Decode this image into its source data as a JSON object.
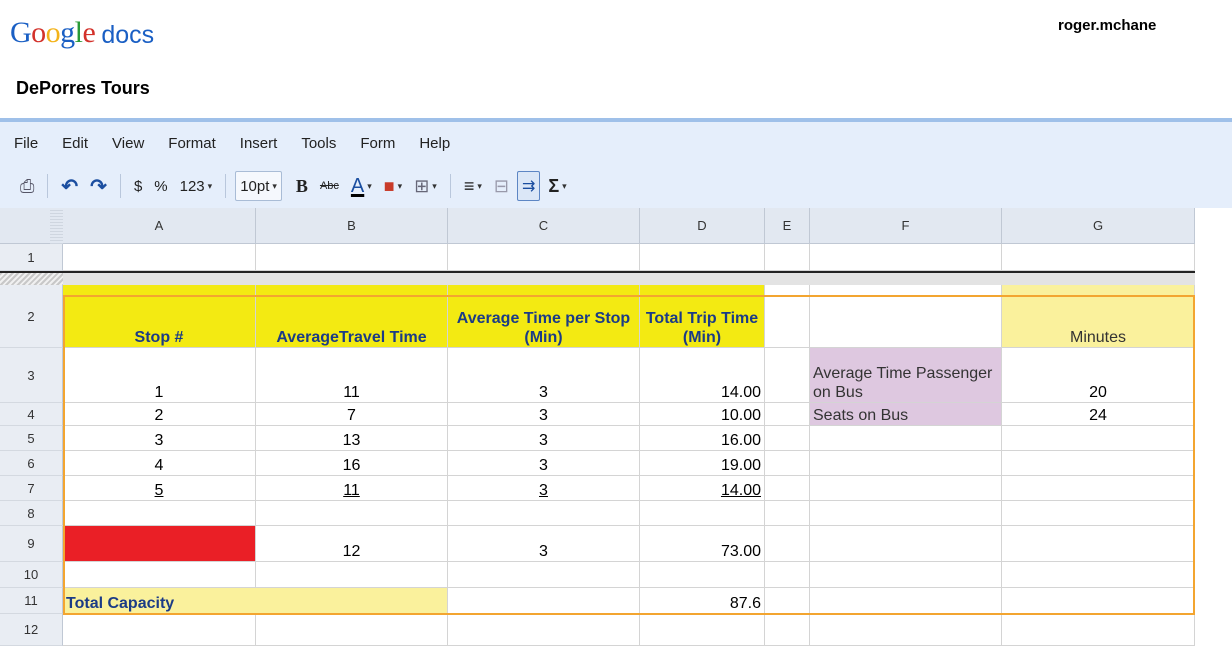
{
  "app": {
    "logo_google": [
      "G",
      "o",
      "o",
      "g",
      "l",
      "e"
    ],
    "logo_colors": [
      "#1a5fc4",
      "#d3312a",
      "#f3b31b",
      "#1a5fc4",
      "#2a9b38",
      "#d3312a"
    ],
    "logo_product": "docs",
    "user": "roger.mchane"
  },
  "document": {
    "title": "DePorres Tours"
  },
  "menu": [
    "File",
    "Edit",
    "View",
    "Format",
    "Insert",
    "Tools",
    "Form",
    "Help"
  ],
  "toolbar": {
    "print_icon": "⎙",
    "undo_icon": "↶",
    "redo_icon": "↷",
    "currency": "$",
    "percent": "%",
    "number_format": "123",
    "font_size": "10pt",
    "bold": "B",
    "strikethrough": "Abc",
    "text_color": "A",
    "fill_color": "■",
    "borders": "⊞",
    "align": "≡",
    "merge": "⊟",
    "wrap": "⇉",
    "functions": "Σ",
    "caret": "▾"
  },
  "columns": [
    "A",
    "B",
    "C",
    "D",
    "E",
    "F",
    "G"
  ],
  "rows": [
    "1",
    "2",
    "3",
    "4",
    "5",
    "6",
    "7",
    "8",
    "9",
    "10",
    "11",
    "12"
  ],
  "cells": {
    "a2": "Stop #",
    "b2": "AverageTravel Time",
    "c2": "Average Time per Stop (Min)",
    "d2": "Total Trip Time (Min)",
    "g2": "Minutes",
    "f3": "Average Time Passenger on Bus",
    "g3": "20",
    "f4": "Seats on Bus",
    "g4": "24",
    "table": [
      {
        "row": "3",
        "stop": "1",
        "travel": "11",
        "per_stop": "3",
        "total": "14.00"
      },
      {
        "row": "4",
        "stop": "2",
        "travel": "7",
        "per_stop": "3",
        "total": "10.00"
      },
      {
        "row": "5",
        "stop": "3",
        "travel": "13",
        "per_stop": "3",
        "total": "16.00"
      },
      {
        "row": "6",
        "stop": "4",
        "travel": "16",
        "per_stop": "3",
        "total": "19.00"
      },
      {
        "row": "7",
        "stop": "5",
        "travel": "11",
        "per_stop": "3",
        "total": "14.00"
      }
    ],
    "b9": "12",
    "c9": "3",
    "d9": "73.00",
    "a11": "Total Capacity",
    "d11": "87.6"
  },
  "colors": {
    "header_yellow": "#f3ea12",
    "light_yellow": "#faf19c",
    "purple": "#dec8e0",
    "red": "#ea1f26",
    "selection_orange": "#f3a530",
    "menu_bg": "#e5eefb"
  }
}
